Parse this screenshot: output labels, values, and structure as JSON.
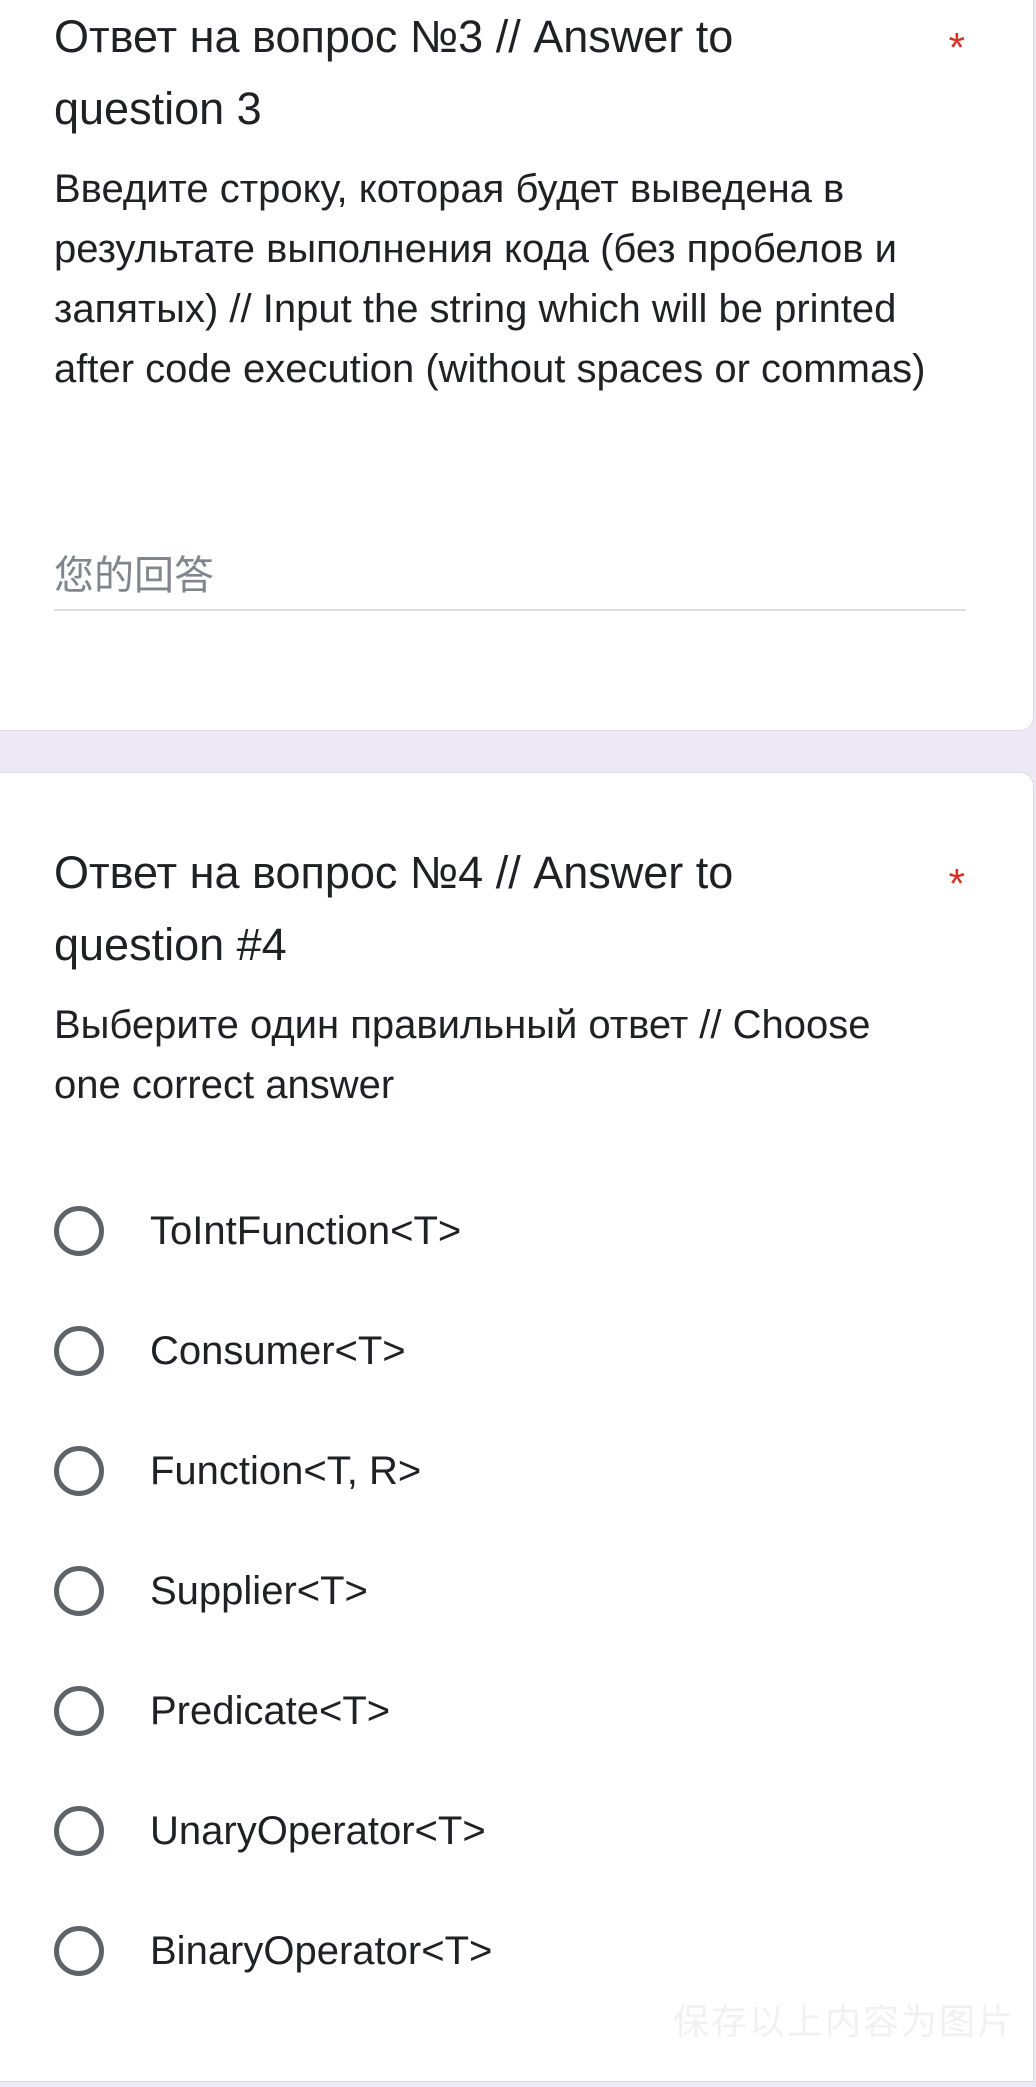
{
  "question3": {
    "title": "Ответ на вопрос №3 // Answer to question 3",
    "required_mark": "*",
    "description": "Введите строку, которая будет выведена в результате выполнения кода (без пробелов и запятых) // Input the string which will be printed after code execution (without spaces or commas)",
    "answer_placeholder": "您的回答",
    "answer_value": ""
  },
  "question4": {
    "title": "Ответ на вопрос №4 // Answer to question #4",
    "required_mark": "*",
    "description": "Выберите один правильный ответ // Choose one correct answer",
    "options": [
      {
        "label": "ToIntFunction<T>",
        "selected": false
      },
      {
        "label": "Consumer<T>",
        "selected": false
      },
      {
        "label": "Function<T, R>",
        "selected": false
      },
      {
        "label": "Supplier<T>",
        "selected": false
      },
      {
        "label": "Predicate<T>",
        "selected": false
      },
      {
        "label": "UnaryOperator<T>",
        "selected": false
      },
      {
        "label": "BinaryOperator<T>",
        "selected": false
      }
    ]
  },
  "watermark": "保存以上内容为图片",
  "colors": {
    "page_background": "#ede8f5",
    "card_background": "#ffffff",
    "required_star": "#d93025",
    "radio_border": "#5f6368",
    "text": "#202124",
    "placeholder": "#80868b"
  }
}
